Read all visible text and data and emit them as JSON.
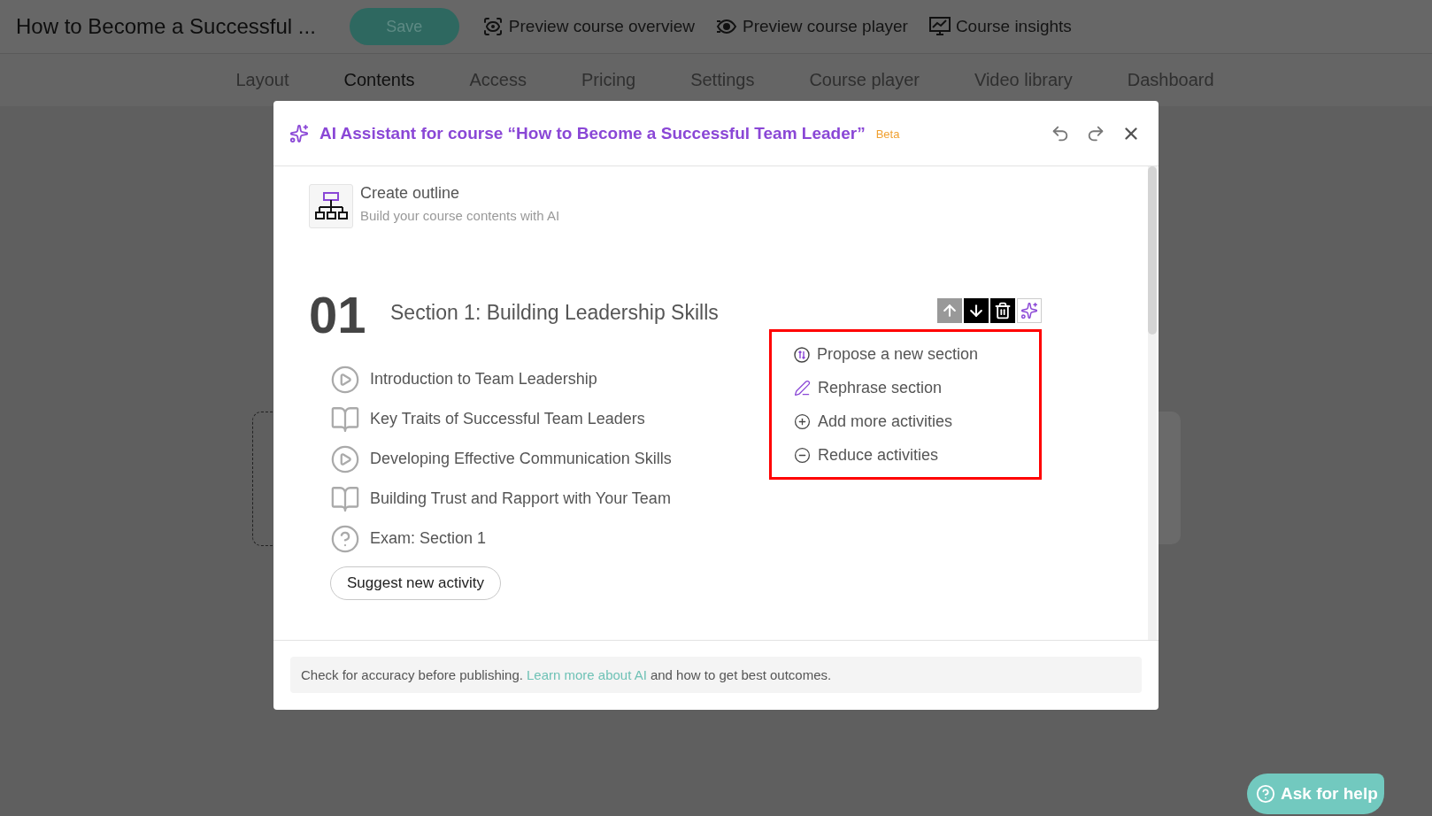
{
  "app": {
    "course_title": "How to Become a Successful ...",
    "save_button": "Save",
    "links": [
      {
        "kind": "overview",
        "label": "Preview course overview"
      },
      {
        "kind": "player",
        "label": "Preview course player"
      },
      {
        "kind": "insights",
        "label": "Course insights"
      }
    ]
  },
  "tabs": [
    {
      "label": "Layout",
      "selected": false
    },
    {
      "label": "Contents",
      "selected": true
    },
    {
      "label": "Access",
      "selected": false
    },
    {
      "label": "Pricing",
      "selected": false
    },
    {
      "label": "Settings",
      "selected": false
    },
    {
      "label": "Course player",
      "selected": false
    },
    {
      "label": "Video library",
      "selected": false
    },
    {
      "label": "Dashboard",
      "selected": false
    }
  ],
  "modal": {
    "title": "AI Assistant for course “How to Become a Successful Team Leader”",
    "badge": "Beta",
    "tool": {
      "title": "Create outline",
      "subtitle": "Build your course contents with AI"
    },
    "section": {
      "number": "01",
      "title": "Section 1: Building Leadership Skills",
      "toolbar": [
        {
          "kind": "up",
          "disabled": true
        },
        {
          "kind": "down",
          "disabled": false
        },
        {
          "kind": "delete",
          "disabled": false
        },
        {
          "kind": "ai",
          "disabled": false
        }
      ],
      "activities": [
        {
          "kind": "video",
          "title": "Introduction to Team Leadership"
        },
        {
          "kind": "text",
          "title": "Key Traits of Successful Team Leaders"
        },
        {
          "kind": "video",
          "title": "Developing Effective Communication Skills"
        },
        {
          "kind": "text",
          "title": "Building Trust and Rapport with Your Team"
        },
        {
          "kind": "exam",
          "title": "Exam: Section 1"
        }
      ],
      "suggest_button": "Suggest new activity",
      "actions_menu": [
        {
          "kind": "propose",
          "label": "Propose a new section"
        },
        {
          "kind": "rephrase",
          "label": "Rephrase section"
        },
        {
          "kind": "add",
          "label": "Add more activities"
        },
        {
          "kind": "reduce",
          "label": "Reduce activities"
        }
      ]
    },
    "notice": {
      "text_before": "Check for accuracy before publishing.",
      "link": "Learn more about AI",
      "text_after": "and how to get best outcomes."
    }
  },
  "help_button": "Ask for help"
}
